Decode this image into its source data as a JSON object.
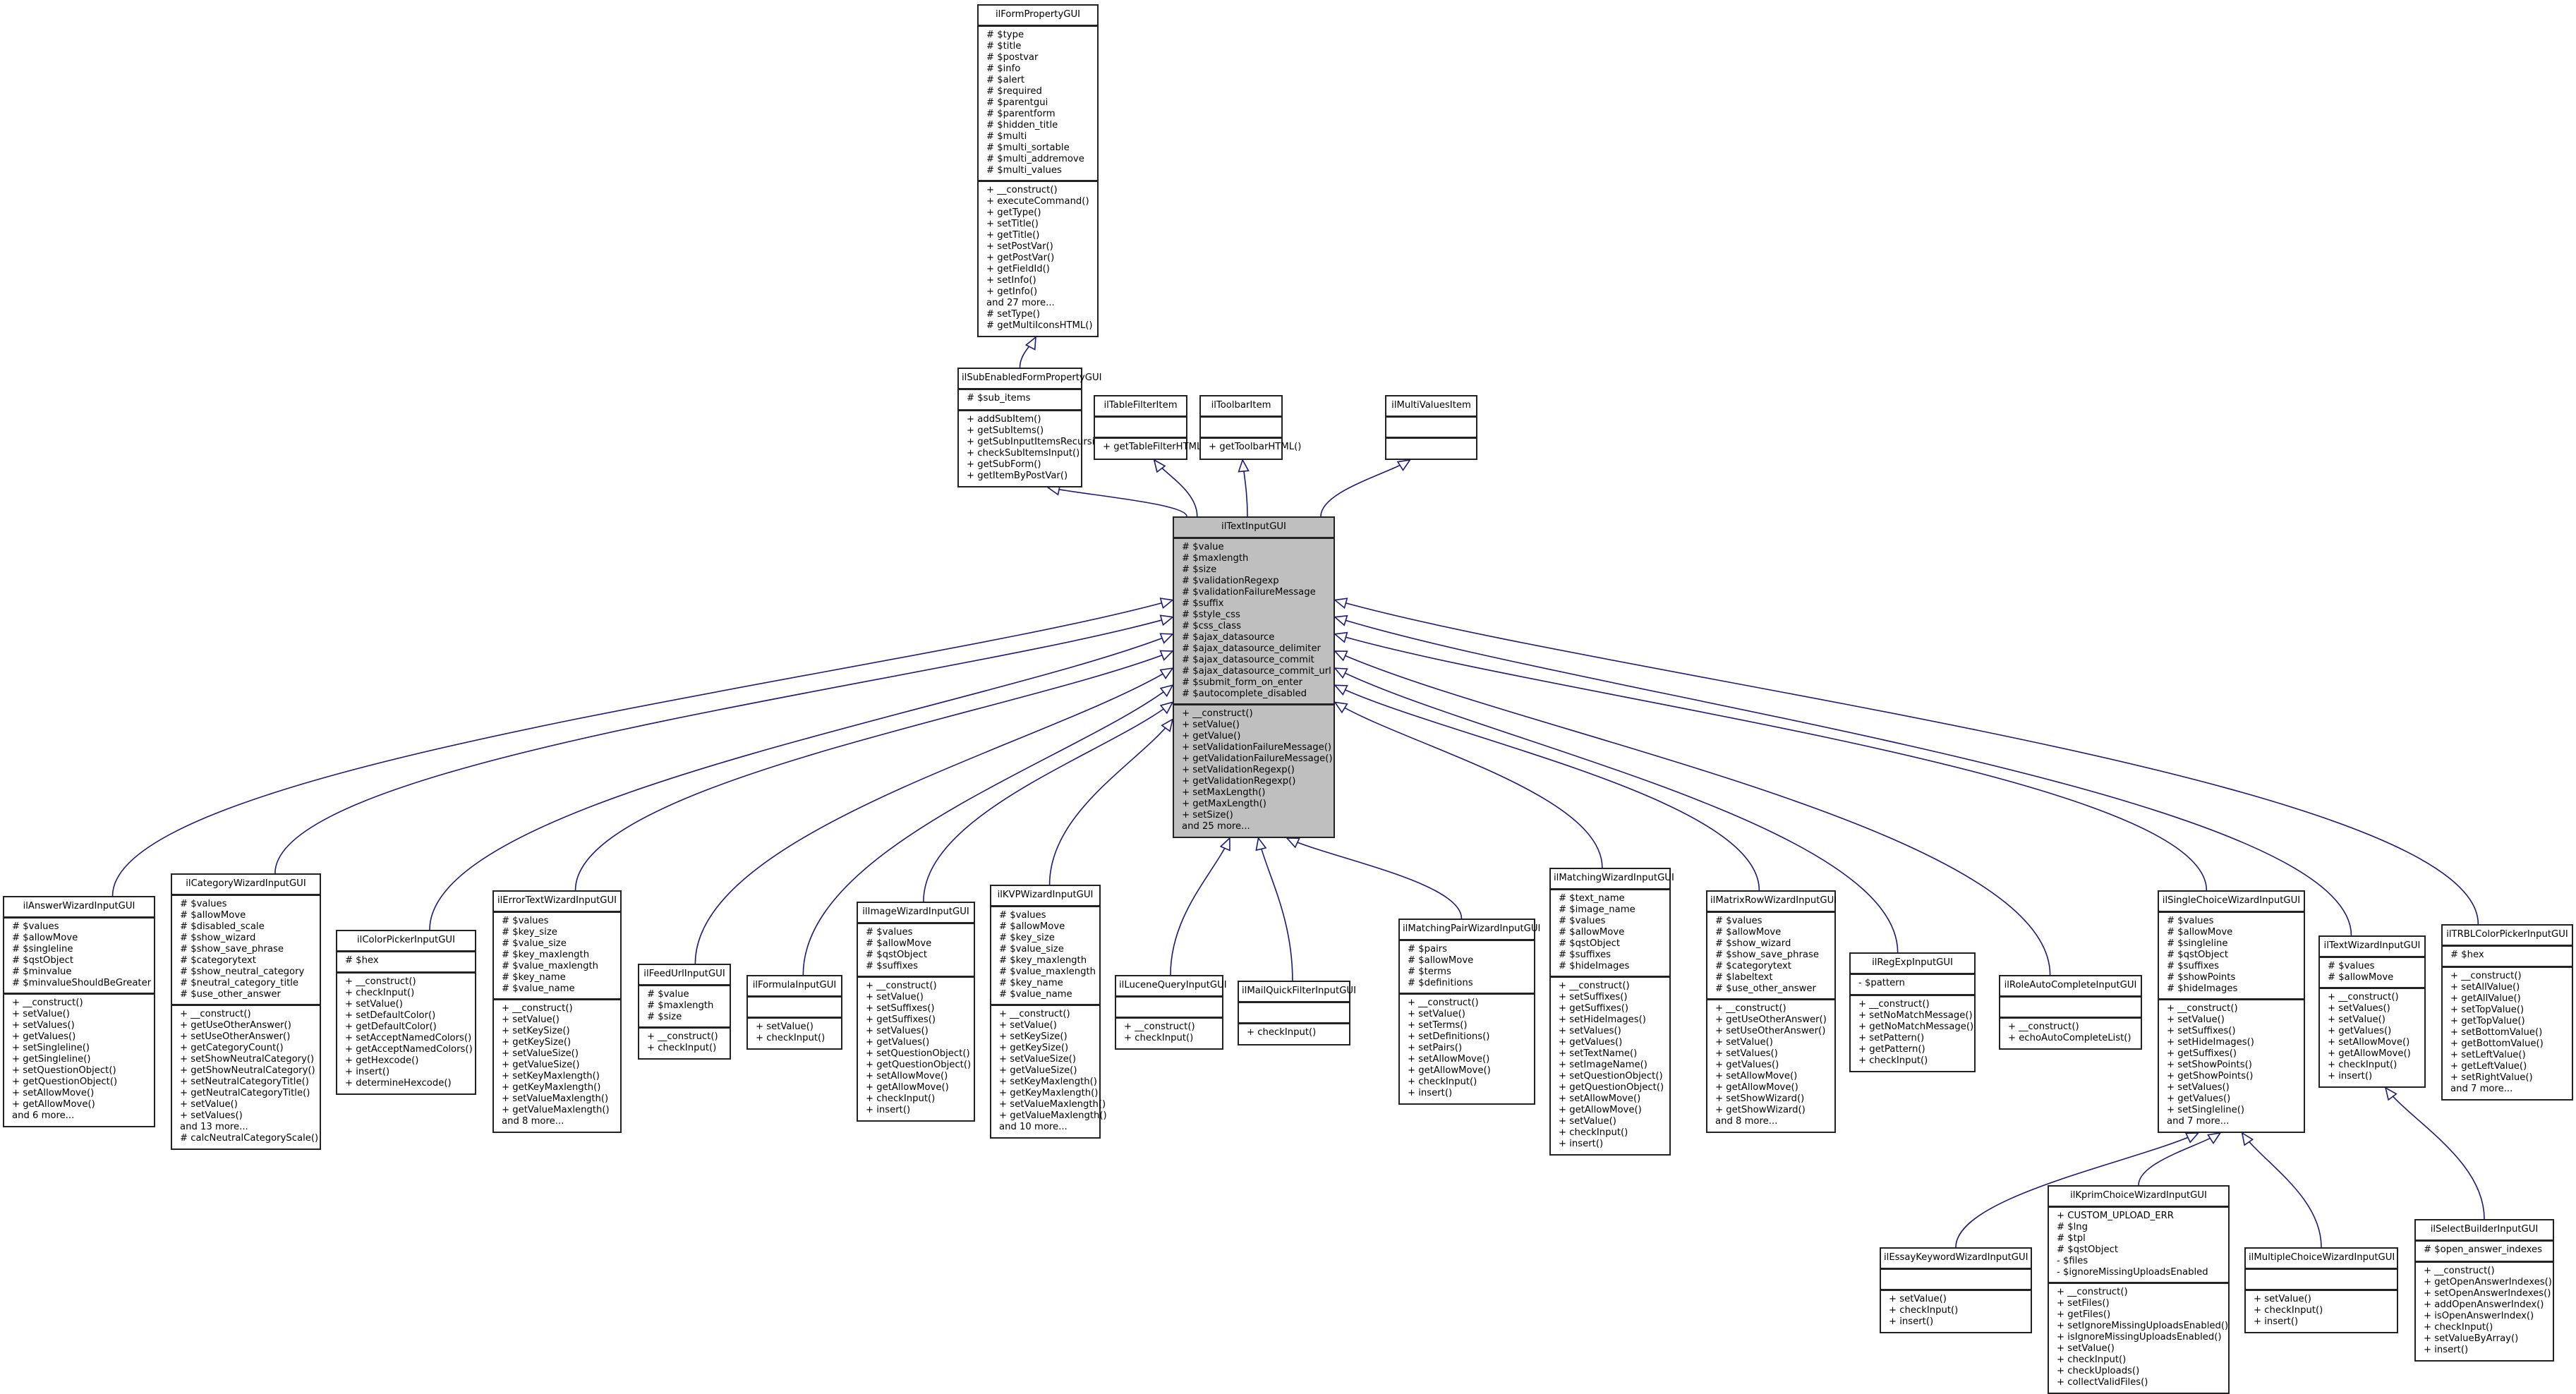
{
  "diagram": {
    "type": "uml-class-inheritance",
    "edge_color": "#1a1a7a",
    "focus_fill": "#bfbfbf",
    "classes": [
      {
        "id": "ilFormPropertyGUI",
        "name": "ilFormPropertyGUI",
        "attributes": [
          "# $type",
          "# $title",
          "# $postvar",
          "# $info",
          "# $alert",
          "# $required",
          "# $parentgui",
          "# $parentform",
          "# $hidden_title",
          "# $multi",
          "# $multi_sortable",
          "# $multi_addremove",
          "# $multi_values"
        ],
        "operations": [
          "+ __construct()",
          "+ executeCommand()",
          "+ getType()",
          "+ setTitle()",
          "+ getTitle()",
          "+ setPostVar()",
          "+ getPostVar()",
          "+ getFieldId()",
          "+ setInfo()",
          "+ getInfo()",
          "and 27 more...",
          "# setType()",
          "# getMultiIconsHTML()"
        ]
      },
      {
        "id": "ilSubEnabledFormPropertyGUI",
        "name": "ilSubEnabledFormPropertyGUI",
        "attributes": [
          "# $sub_items"
        ],
        "operations": [
          "+ addSubItem()",
          "+ getSubItems()",
          "+ getSubInputItemsRecursive()",
          "+ checkSubItemsInput()",
          "+ getSubForm()",
          "+ getItemByPostVar()"
        ]
      },
      {
        "id": "ilTableFilterItem",
        "name": "ilTableFilterItem",
        "attributes": [],
        "operations": [
          "+ getTableFilterHTML()"
        ]
      },
      {
        "id": "ilToolbarItem",
        "name": "ilToolbarItem",
        "attributes": [],
        "operations": [
          "+ getToolbarHTML()"
        ]
      },
      {
        "id": "ilMultiValuesItem",
        "name": "ilMultiValuesItem",
        "attributes": [],
        "operations": []
      },
      {
        "id": "ilTextInputGUI",
        "name": "ilTextInputGUI",
        "focus": true,
        "attributes": [
          "# $value",
          "# $maxlength",
          "# $size",
          "# $validationRegexp",
          "# $validationFailureMessage",
          "# $suffix",
          "# $style_css",
          "# $css_class",
          "# $ajax_datasource",
          "# $ajax_datasource_delimiter",
          "# $ajax_datasource_commit",
          "# $ajax_datasource_commit_url",
          "# $submit_form_on_enter",
          "# $autocomplete_disabled"
        ],
        "operations": [
          "+ __construct()",
          "+ setValue()",
          "+ getValue()",
          "+ setValidationFailureMessage()",
          "+ getValidationFailureMessage()",
          "+ setValidationRegexp()",
          "+ getValidationRegexp()",
          "+ setMaxLength()",
          "+ getMaxLength()",
          "+ setSize()",
          "and 25 more..."
        ]
      },
      {
        "id": "ilAnswerWizardInputGUI",
        "name": "ilAnswerWizardInputGUI",
        "attributes": [
          "# $values",
          "# $allowMove",
          "# $singleline",
          "# $qstObject",
          "# $minvalue",
          "# $minvalueShouldBeGreater"
        ],
        "operations": [
          "+ __construct()",
          "+ setValue()",
          "+ setValues()",
          "+ getValues()",
          "+ setSingleline()",
          "+ getSingleline()",
          "+ setQuestionObject()",
          "+ getQuestionObject()",
          "+ setAllowMove()",
          "+ getAllowMove()",
          "and 6 more..."
        ]
      },
      {
        "id": "ilCategoryWizardInputGUI",
        "name": "ilCategoryWizardInputGUI",
        "attributes": [
          "# $values",
          "# $allowMove",
          "# $disabled_scale",
          "# $show_wizard",
          "# $show_save_phrase",
          "# $categorytext",
          "# $show_neutral_category",
          "# $neutral_category_title",
          "# $use_other_answer"
        ],
        "operations": [
          "+ __construct()",
          "+ getUseOtherAnswer()",
          "+ setUseOtherAnswer()",
          "+ getCategoryCount()",
          "+ setShowNeutralCategory()",
          "+ getShowNeutralCategory()",
          "+ setNeutralCategoryTitle()",
          "+ getNeutralCategoryTitle()",
          "+ setValue()",
          "+ setValues()",
          "and 13 more...",
          "# calcNeutralCategoryScale()"
        ]
      },
      {
        "id": "ilColorPickerInputGUI",
        "name": "ilColorPickerInputGUI",
        "attributes": [
          "# $hex"
        ],
        "operations": [
          "+ __construct()",
          "+ checkInput()",
          "+ setValue()",
          "+ setDefaultColor()",
          "+ getDefaultColor()",
          "+ setAcceptNamedColors()",
          "+ getAcceptNamedColors()",
          "+ getHexcode()",
          "+ insert()",
          "+ determineHexcode()"
        ]
      },
      {
        "id": "ilErrorTextWizardInputGUI",
        "name": "ilErrorTextWizardInputGUI",
        "attributes": [
          "# $values",
          "# $key_size",
          "# $value_size",
          "# $key_maxlength",
          "# $value_maxlength",
          "# $key_name",
          "# $value_name"
        ],
        "operations": [
          "+ __construct()",
          "+ setValue()",
          "+ setKeySize()",
          "+ getKeySize()",
          "+ setValueSize()",
          "+ getValueSize()",
          "+ setKeyMaxlength()",
          "+ getKeyMaxlength()",
          "+ setValueMaxlength()",
          "+ getValueMaxlength()",
          "and 8 more..."
        ]
      },
      {
        "id": "ilFeedUrlInputGUI",
        "name": "ilFeedUrlInputGUI",
        "attributes": [
          "# $value",
          "# $maxlength",
          "# $size"
        ],
        "operations": [
          "+ __construct()",
          "+ checkInput()"
        ]
      },
      {
        "id": "ilFormulaInputGUI",
        "name": "ilFormulaInputGUI",
        "attributes": [],
        "operations": [
          "+ setValue()",
          "+ checkInput()"
        ]
      },
      {
        "id": "ilImageWizardInputGUI",
        "name": "ilImageWizardInputGUI",
        "attributes": [
          "# $values",
          "# $allowMove",
          "# $qstObject",
          "# $suffixes"
        ],
        "operations": [
          "+ __construct()",
          "+ setValue()",
          "+ setSuffixes()",
          "+ getSuffixes()",
          "+ setValues()",
          "+ getValues()",
          "+ setQuestionObject()",
          "+ getQuestionObject()",
          "+ setAllowMove()",
          "+ getAllowMove()",
          "+ checkInput()",
          "+ insert()"
        ]
      },
      {
        "id": "ilKVPWizardInputGUI",
        "name": "ilKVPWizardInputGUI",
        "attributes": [
          "# $values",
          "# $allowMove",
          "# $key_size",
          "# $value_size",
          "# $key_maxlength",
          "# $value_maxlength",
          "# $key_name",
          "# $value_name"
        ],
        "operations": [
          "+ __construct()",
          "+ setValue()",
          "+ setKeySize()",
          "+ getKeySize()",
          "+ setValueSize()",
          "+ getValueSize()",
          "+ setKeyMaxlength()",
          "+ getKeyMaxlength()",
          "+ setValueMaxlength()",
          "+ getValueMaxlength()",
          "and 10 more..."
        ]
      },
      {
        "id": "ilLuceneQueryInputGUI",
        "name": "ilLuceneQueryInputGUI",
        "attributes": [],
        "operations": [
          "+ __construct()",
          "+ checkInput()"
        ]
      },
      {
        "id": "ilMailQuickFilterInputGUI",
        "name": "ilMailQuickFilterInputGUI",
        "attributes": [],
        "operations": [
          "+ checkInput()"
        ]
      },
      {
        "id": "ilMatchingPairWizardInputGUI",
        "name": "ilMatchingPairWizardInputGUI",
        "attributes": [
          "# $pairs",
          "# $allowMove",
          "# $terms",
          "# $definitions"
        ],
        "operations": [
          "+ __construct()",
          "+ setValue()",
          "+ setTerms()",
          "+ setDefinitions()",
          "+ setPairs()",
          "+ setAllowMove()",
          "+ getAllowMove()",
          "+ checkInput()",
          "+ insert()"
        ]
      },
      {
        "id": "ilMatchingWizardInputGUI",
        "name": "ilMatchingWizardInputGUI",
        "attributes": [
          "# $text_name",
          "# $image_name",
          "# $values",
          "# $allowMove",
          "# $qstObject",
          "# $suffixes",
          "# $hideImages"
        ],
        "operations": [
          "+ __construct()",
          "+ setSuffixes()",
          "+ getSuffixes()",
          "+ setHideImages()",
          "+ setValues()",
          "+ getValues()",
          "+ setTextName()",
          "+ setImageName()",
          "+ setQuestionObject()",
          "+ getQuestionObject()",
          "+ setAllowMove()",
          "+ getAllowMove()",
          "+ setValue()",
          "+ checkInput()",
          "+ insert()"
        ]
      },
      {
        "id": "ilMatrixRowWizardInputGUI",
        "name": "ilMatrixRowWizardInputGUI",
        "attributes": [
          "# $values",
          "# $allowMove",
          "# $show_wizard",
          "# $show_save_phrase",
          "# $categorytext",
          "# $labeltext",
          "# $use_other_answer"
        ],
        "operations": [
          "+ __construct()",
          "+ getUseOtherAnswer()",
          "+ setUseOtherAnswer()",
          "+ setValue()",
          "+ setValues()",
          "+ getValues()",
          "+ setAllowMove()",
          "+ getAllowMove()",
          "+ setShowWizard()",
          "+ getShowWizard()",
          "and 8 more..."
        ]
      },
      {
        "id": "ilRegExpInputGUI",
        "name": "ilRegExpInputGUI",
        "attributes": [
          "- $pattern"
        ],
        "operations": [
          "+ __construct()",
          "+ setNoMatchMessage()",
          "+ getNoMatchMessage()",
          "+ setPattern()",
          "+ getPattern()",
          "+ checkInput()"
        ]
      },
      {
        "id": "ilRoleAutoCompleteInputGUI",
        "name": "ilRoleAutoCompleteInputGUI",
        "attributes": [],
        "operations": [
          "+ __construct()",
          "+ echoAutoCompleteList()"
        ]
      },
      {
        "id": "ilSingleChoiceWizardInputGUI",
        "name": "ilSingleChoiceWizardInputGUI",
        "attributes": [
          "# $values",
          "# $allowMove",
          "# $singleline",
          "# $qstObject",
          "# $suffixes",
          "# $showPoints",
          "# $hideImages"
        ],
        "operations": [
          "+ __construct()",
          "+ setValue()",
          "+ setSuffixes()",
          "+ setHideImages()",
          "+ getSuffixes()",
          "+ setShowPoints()",
          "+ getShowPoints()",
          "+ setValues()",
          "+ getValues()",
          "+ setSingleline()",
          "and 7 more..."
        ]
      },
      {
        "id": "ilTextWizardInputGUI",
        "name": "ilTextWizardInputGUI",
        "attributes": [
          "# $values",
          "# $allowMove"
        ],
        "operations": [
          "+ __construct()",
          "+ setValues()",
          "+ setValue()",
          "+ getValues()",
          "+ setAllowMove()",
          "+ getAllowMove()",
          "+ checkInput()",
          "+ insert()"
        ]
      },
      {
        "id": "ilTRBLColorPickerInputGUI",
        "name": "ilTRBLColorPickerInputGUI",
        "attributes": [
          "# $hex"
        ],
        "operations": [
          "+ __construct()",
          "+ setAllValue()",
          "+ getAllValue()",
          "+ setTopValue()",
          "+ getTopValue()",
          "+ setBottomValue()",
          "+ getBottomValue()",
          "+ setLeftValue()",
          "+ getLeftValue()",
          "+ setRightValue()",
          "and 7 more..."
        ]
      },
      {
        "id": "ilEssayKeywordWizardInputGUI",
        "name": "ilEssayKeywordWizardInputGUI",
        "attributes": [],
        "operations": [
          "+ setValue()",
          "+ checkInput()",
          "+ insert()"
        ]
      },
      {
        "id": "ilKprimChoiceWizardInputGUI",
        "name": "ilKprimChoiceWizardInputGUI",
        "attributes": [
          "+ CUSTOM_UPLOAD_ERR",
          "# $lng",
          "# $tpl",
          "# $qstObject",
          "- $files",
          "- $ignoreMissingUploadsEnabled"
        ],
        "operations": [
          "+ __construct()",
          "+ setFiles()",
          "+ getFiles()",
          "+ setIgnoreMissingUploadsEnabled()",
          "+ isIgnoreMissingUploadsEnabled()",
          "+ setValue()",
          "+ checkInput()",
          "+ checkUploads()",
          "+ collectValidFiles()"
        ]
      },
      {
        "id": "ilMultipleChoiceWizardInputGUI",
        "name": "ilMultipleChoiceWizardInputGUI",
        "attributes": [],
        "operations": [
          "+ setValue()",
          "+ checkInput()",
          "+ insert()"
        ]
      },
      {
        "id": "ilSelectBuilderInputGUI",
        "name": "ilSelectBuilderInputGUI",
        "attributes": [
          "# $open_answer_indexes"
        ],
        "operations": [
          "+ __construct()",
          "+ getOpenAnswerIndexes()",
          "+ setOpenAnswerIndexes()",
          "+ addOpenAnswerIndex()",
          "+ isOpenAnswerIndex()",
          "+ checkInput()",
          "+ setValueByArray()",
          "+ insert()"
        ]
      }
    ],
    "inheritance": [
      {
        "child": "ilSubEnabledFormPropertyGUI",
        "parent": "ilFormPropertyGUI"
      },
      {
        "child": "ilTextInputGUI",
        "parent": "ilSubEnabledFormPropertyGUI"
      },
      {
        "child": "ilTextInputGUI",
        "parent": "ilTableFilterItem"
      },
      {
        "child": "ilTextInputGUI",
        "parent": "ilToolbarItem"
      },
      {
        "child": "ilTextInputGUI",
        "parent": "ilMultiValuesItem"
      },
      {
        "child": "ilAnswerWizardInputGUI",
        "parent": "ilTextInputGUI"
      },
      {
        "child": "ilCategoryWizardInputGUI",
        "parent": "ilTextInputGUI"
      },
      {
        "child": "ilColorPickerInputGUI",
        "parent": "ilTextInputGUI"
      },
      {
        "child": "ilErrorTextWizardInputGUI",
        "parent": "ilTextInputGUI"
      },
      {
        "child": "ilFeedUrlInputGUI",
        "parent": "ilTextInputGUI"
      },
      {
        "child": "ilFormulaInputGUI",
        "parent": "ilTextInputGUI"
      },
      {
        "child": "ilImageWizardInputGUI",
        "parent": "ilTextInputGUI"
      },
      {
        "child": "ilKVPWizardInputGUI",
        "parent": "ilTextInputGUI"
      },
      {
        "child": "ilLuceneQueryInputGUI",
        "parent": "ilTextInputGUI"
      },
      {
        "child": "ilMailQuickFilterInputGUI",
        "parent": "ilTextInputGUI"
      },
      {
        "child": "ilMatchingPairWizardInputGUI",
        "parent": "ilTextInputGUI"
      },
      {
        "child": "ilMatchingWizardInputGUI",
        "parent": "ilTextInputGUI"
      },
      {
        "child": "ilMatrixRowWizardInputGUI",
        "parent": "ilTextInputGUI"
      },
      {
        "child": "ilRegExpInputGUI",
        "parent": "ilTextInputGUI"
      },
      {
        "child": "ilRoleAutoCompleteInputGUI",
        "parent": "ilTextInputGUI"
      },
      {
        "child": "ilSingleChoiceWizardInputGUI",
        "parent": "ilTextInputGUI"
      },
      {
        "child": "ilTextWizardInputGUI",
        "parent": "ilTextInputGUI"
      },
      {
        "child": "ilTRBLColorPickerInputGUI",
        "parent": "ilTextInputGUI"
      },
      {
        "child": "ilEssayKeywordWizardInputGUI",
        "parent": "ilSingleChoiceWizardInputGUI"
      },
      {
        "child": "ilKprimChoiceWizardInputGUI",
        "parent": "ilSingleChoiceWizardInputGUI"
      },
      {
        "child": "ilMultipleChoiceWizardInputGUI",
        "parent": "ilSingleChoiceWizardInputGUI"
      },
      {
        "child": "ilSelectBuilderInputGUI",
        "parent": "ilTextWizardInputGUI"
      }
    ]
  }
}
